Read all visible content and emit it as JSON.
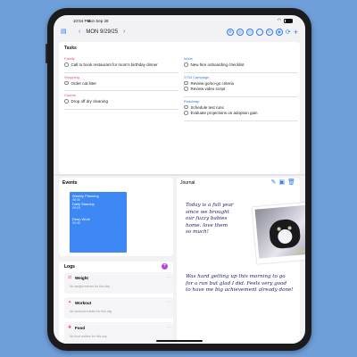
{
  "status": {
    "time": "10:54 PM",
    "date": "Sun Sep 28"
  },
  "nav": {
    "date": "MON 9/29/25"
  },
  "tasks": {
    "title": "Tasks",
    "left_groups": [
      {
        "name": "Family",
        "items": [
          "Call to book restaurant for mom's birthday dinner"
        ]
      },
      {
        "name": "Shopping",
        "items": [
          "Order cat litter"
        ]
      },
      {
        "name": "Chores",
        "items": [
          "Drop off dry cleaning"
        ]
      }
    ],
    "right_groups": [
      {
        "name": "Inbox",
        "items": [
          "New hire onboarding checklist"
        ]
      },
      {
        "name": "GTM Campaign",
        "items": [
          "Review go/no-go criteria",
          "Review video script"
        ]
      },
      {
        "name": "Roadmap",
        "items": [
          "Schedule test runs",
          "Evaluate projections on adoption gain"
        ]
      }
    ]
  },
  "events": {
    "title": "Events",
    "items": [
      {
        "title": "Weekly Planning",
        "time": "08:30",
        "title2": "Daily Standup",
        "time2": "09:15"
      },
      {
        "title": "Deep Work",
        "time": "09:30"
      }
    ]
  },
  "logs": {
    "title": "Logs",
    "plus": "+",
    "cards": [
      {
        "title": "Weight",
        "sub": "No weight entries for this day"
      },
      {
        "title": "Workout",
        "sub": "No workout entries for this day"
      },
      {
        "title": "Food",
        "sub": "No food entries for this day"
      }
    ]
  },
  "journal": {
    "title": "Journal",
    "hand_lines_a": [
      "Today is a full year",
      "since we brought",
      "our fuzzy babies",
      "home. love them",
      "so much!"
    ],
    "hand_lines_b": [
      "Was hard getting up this morning to go",
      "for a run but glad I did. Feels very good",
      "to have me big achievement already done!"
    ],
    "photo_caption": "Love"
  }
}
